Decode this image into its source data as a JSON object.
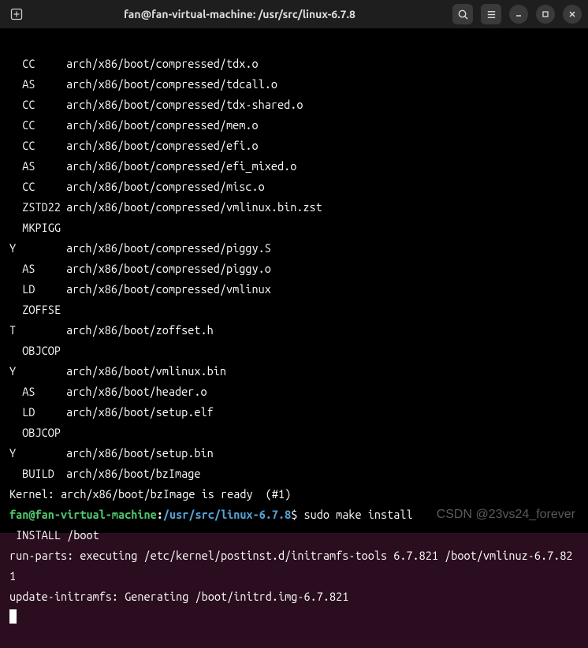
{
  "titlebar": {
    "title": "fan@fan-virtual-machine: /usr/src/linux-6.7.8"
  },
  "terminal": {
    "build_lines": [
      {
        "stage": "CC",
        "path": "arch/x86/boot/compressed/tdx.o"
      },
      {
        "stage": "AS",
        "path": "arch/x86/boot/compressed/tdcall.o"
      },
      {
        "stage": "CC",
        "path": "arch/x86/boot/compressed/tdx-shared.o"
      },
      {
        "stage": "CC",
        "path": "arch/x86/boot/compressed/mem.o"
      },
      {
        "stage": "CC",
        "path": "arch/x86/boot/compressed/efi.o"
      },
      {
        "stage": "AS",
        "path": "arch/x86/boot/compressed/efi_mixed.o"
      },
      {
        "stage": "CC",
        "path": "arch/x86/boot/compressed/misc.o"
      },
      {
        "stage": "ZSTD22",
        "path": "arch/x86/boot/compressed/vmlinux.bin.zst"
      },
      {
        "stage": "MKPIGGY",
        "path": "arch/x86/boot/compressed/piggy.S"
      },
      {
        "stage": "AS",
        "path": "arch/x86/boot/compressed/piggy.o"
      },
      {
        "stage": "LD",
        "path": "arch/x86/boot/compressed/vmlinux"
      },
      {
        "stage": "ZOFFSET",
        "path": "arch/x86/boot/zoffset.h"
      },
      {
        "stage": "OBJCOPY",
        "path": "arch/x86/boot/vmlinux.bin"
      },
      {
        "stage": "AS",
        "path": "arch/x86/boot/header.o"
      },
      {
        "stage": "LD",
        "path": "arch/x86/boot/setup.elf"
      },
      {
        "stage": "OBJCOPY",
        "path": "arch/x86/boot/setup.bin"
      },
      {
        "stage": "BUILD",
        "path": "arch/x86/boot/bzImage"
      }
    ],
    "kernel_ready": "Kernel: arch/x86/boot/bzImage is ready  (#1)",
    "prompt": {
      "user": "fan@fan-virtual-machine",
      "colon": ":",
      "path": "/usr/src/linux-6.7.8",
      "dollar": "$ ",
      "command": "sudo make install"
    },
    "post_lines": [
      " INSTALL /boot",
      "run-parts: executing /etc/kernel/postinst.d/initramfs-tools 6.7.821 /boot/vmlinuz-6.7.821",
      "update-initramfs: Generating /boot/initrd.img-6.7.821"
    ]
  },
  "watermark": "CSDN @23vs24_forever"
}
